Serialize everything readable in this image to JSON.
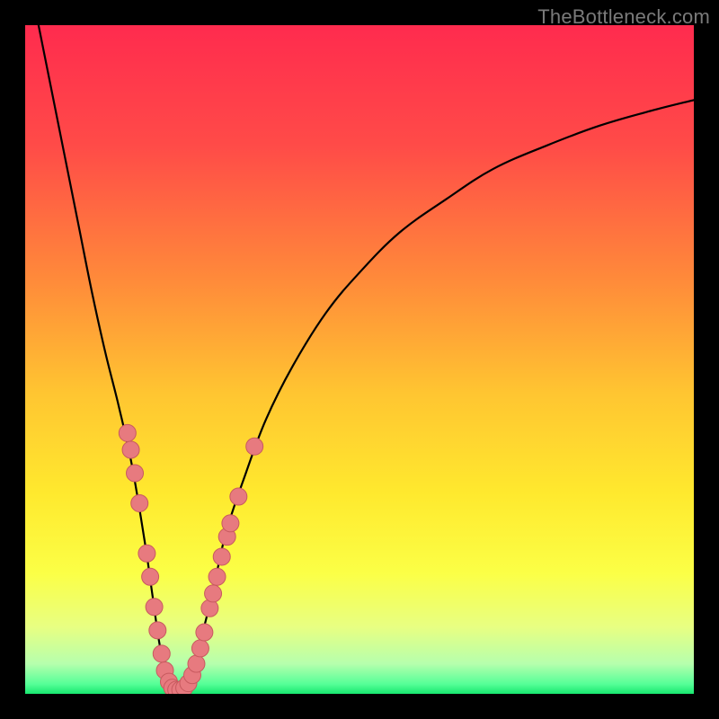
{
  "watermark": "TheBottleneck.com",
  "colors": {
    "frame": "#000000",
    "curve": "#000000",
    "dot_fill": "#e77a7f",
    "dot_stroke": "#c85a5f",
    "gradient_stops": [
      {
        "offset": 0.0,
        "color": "#ff2b4e"
      },
      {
        "offset": 0.18,
        "color": "#ff4b48"
      },
      {
        "offset": 0.38,
        "color": "#ff8a3a"
      },
      {
        "offset": 0.55,
        "color": "#ffc531"
      },
      {
        "offset": 0.7,
        "color": "#ffe92e"
      },
      {
        "offset": 0.82,
        "color": "#fbff46"
      },
      {
        "offset": 0.9,
        "color": "#e8ff82"
      },
      {
        "offset": 0.955,
        "color": "#b6ffad"
      },
      {
        "offset": 0.985,
        "color": "#57ff98"
      },
      {
        "offset": 1.0,
        "color": "#18e86f"
      }
    ]
  },
  "chart_data": {
    "type": "line",
    "title": "",
    "xlabel": "",
    "ylabel": "",
    "xlim": [
      0,
      100
    ],
    "ylim": [
      0,
      100
    ],
    "series": [
      {
        "name": "bottleneck-curve",
        "x": [
          2,
          4,
          6,
          8,
          10,
          12,
          14,
          16,
          18,
          19,
          20,
          21,
          22,
          23,
          24,
          25,
          26,
          28,
          30,
          33,
          36,
          40,
          45,
          50,
          56,
          63,
          70,
          78,
          86,
          94,
          100
        ],
        "y": [
          100,
          90,
          80,
          70,
          60,
          51,
          43,
          34,
          22,
          15,
          8,
          3,
          1,
          0.5,
          1,
          3,
          7,
          15,
          24,
          33,
          41,
          49,
          57,
          63,
          69,
          74,
          78.5,
          82,
          85,
          87.3,
          88.8
        ]
      }
    ],
    "scatter": [
      {
        "name": "left-cluster",
        "points": [
          [
            15.3,
            39.0
          ],
          [
            15.8,
            36.5
          ],
          [
            16.4,
            33.0
          ],
          [
            17.1,
            28.5
          ],
          [
            18.2,
            21.0
          ],
          [
            18.7,
            17.5
          ],
          [
            19.3,
            13.0
          ],
          [
            19.8,
            9.5
          ],
          [
            20.4,
            6.0
          ],
          [
            20.9,
            3.5
          ],
          [
            21.5,
            1.8
          ]
        ]
      },
      {
        "name": "bottom-cluster",
        "points": [
          [
            22.0,
            0.9
          ],
          [
            22.6,
            0.6
          ],
          [
            23.2,
            0.6
          ],
          [
            23.8,
            0.9
          ],
          [
            24.4,
            1.6
          ],
          [
            25.0,
            2.8
          ]
        ]
      },
      {
        "name": "right-cluster",
        "points": [
          [
            25.6,
            4.5
          ],
          [
            26.2,
            6.8
          ],
          [
            26.8,
            9.2
          ],
          [
            27.6,
            12.8
          ],
          [
            28.1,
            15.0
          ],
          [
            28.7,
            17.5
          ],
          [
            29.4,
            20.5
          ],
          [
            30.2,
            23.5
          ],
          [
            30.7,
            25.5
          ],
          [
            31.9,
            29.5
          ],
          [
            34.3,
            37.0
          ]
        ]
      }
    ]
  }
}
